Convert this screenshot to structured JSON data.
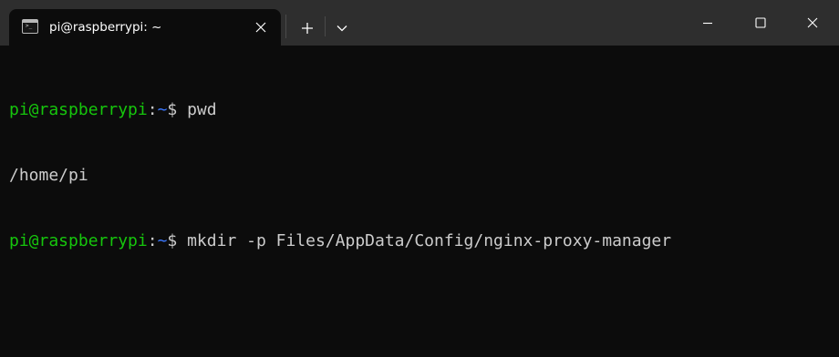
{
  "window": {
    "tab_title": "pi@raspberrypi: ~",
    "tab_icon": "terminal-icon",
    "icons": {
      "close_tab": "close-icon",
      "new_tab": "plus-icon",
      "dropdown": "chevron-down-icon",
      "minimize": "minimize-icon",
      "maximize": "maximize-icon",
      "close_window": "close-icon"
    }
  },
  "terminal": {
    "lines": [
      {
        "user": "pi@raspberrypi",
        "sep": ":",
        "path": "~",
        "prompt": "$ ",
        "command": "pwd"
      },
      {
        "output": "/home/pi"
      },
      {
        "user": "pi@raspberrypi",
        "sep": ":",
        "path": "~",
        "prompt": "$ ",
        "command": "mkdir -p Files/AppData/Config/nginx-proxy-manager"
      }
    ]
  },
  "colors": {
    "background": "#0c0c0c",
    "titlebar": "#2e2e2e",
    "prompt_user": "#16c60c",
    "prompt_path": "#3b78ff",
    "text": "#cccccc"
  }
}
